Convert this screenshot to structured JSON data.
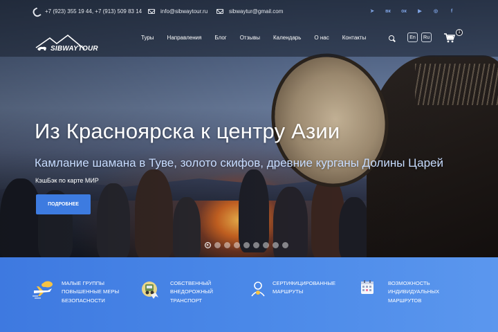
{
  "topbar": {
    "phones": "+7 (923) 355 19 44, +7 (913) 509 83 14",
    "email1": "info@sibwaytour.ru",
    "email2": "sibwaytur@gmail.com",
    "socials": [
      {
        "name": "telegram-icon",
        "glyph": "➤"
      },
      {
        "name": "vk-icon",
        "glyph": "вк"
      },
      {
        "name": "odnoklassniki-icon",
        "glyph": "ок"
      },
      {
        "name": "youtube-icon",
        "glyph": "▶"
      },
      {
        "name": "instagram-icon",
        "glyph": "◎"
      },
      {
        "name": "facebook-icon",
        "glyph": "f"
      }
    ]
  },
  "nav": {
    "logo_text": "SIBWAYTOUR",
    "links": [
      "Туры",
      "Направления",
      "Блог",
      "Отзывы",
      "Календарь",
      "О нас",
      "Контакты"
    ],
    "lang_en": "En",
    "lang_ru": "Ru",
    "cart_count": "1"
  },
  "hero": {
    "title": "Из Красноярска к центру Азии",
    "subtitle": "Камлание шамана в Туве, золото скифов, древние курганы Долины Царей",
    "cashback": "КэшБэк по карте МИР",
    "button": "ПОДРОБНЕЕ",
    "slide_count": 9,
    "active_slide": 1
  },
  "features": [
    {
      "icon": "plane-cloud-icon",
      "text": "Малые группы повышенные меры безопасности"
    },
    {
      "icon": "jeep-icon",
      "text": "Собственный внедорожный транспорт"
    },
    {
      "icon": "certified-guide-icon",
      "text": "Сертифицированные маршруты"
    },
    {
      "icon": "calendar-icon",
      "text": "Возможность индивидуальных маршрутов"
    }
  ],
  "colors": {
    "accent": "#3d7be0",
    "features_bg": "#4a88e8",
    "subtitle": "#c7dcff"
  }
}
